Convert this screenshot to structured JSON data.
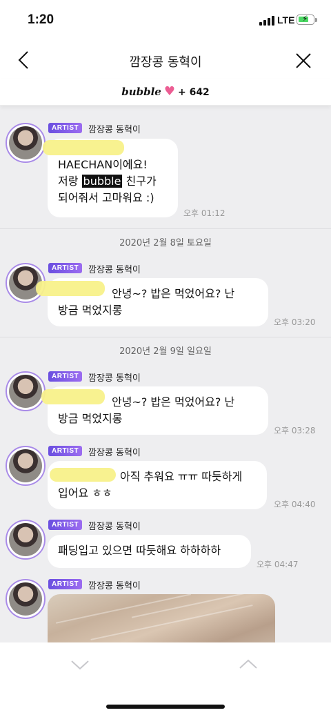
{
  "status_bar": {
    "time": "1:20",
    "network": "LTE"
  },
  "nav": {
    "title": "깜장콩 동혁이",
    "back_icon": "chevron-left-icon",
    "close_icon": "close-icon"
  },
  "banner": {
    "logo": "bubble",
    "count": "+ 642",
    "heart_color": "#ec5d93"
  },
  "colors": {
    "chat_bg": "#eeeef0",
    "badge": "#7c5ae8",
    "avatar_ring": "#a98be8"
  },
  "messages": [
    {
      "badge": "ARTIST",
      "sender": "깜장콩 동혁이",
      "lines": [
        "HAECHAN이에요!",
        "저랑",
        "bubble",
        "친구가",
        "되어줘서 고마워요 :)"
      ],
      "time": "오후 01:12"
    },
    {
      "badge": "ARTIST",
      "sender": "깜장콩 동혁이",
      "lines": [
        "안녕~? 밥은 먹었어요? 난",
        "방금 먹었지롱"
      ],
      "time": "오후 03:20"
    },
    {
      "badge": "ARTIST",
      "sender": "깜장콩 동혁이",
      "lines": [
        "안녕~? 밥은 먹었어요? 난",
        "방금 먹었지롱"
      ],
      "time": "오후 03:28"
    },
    {
      "badge": "ARTIST",
      "sender": "깜장콩 동혁이",
      "lines": [
        "아직 추워요 ㅠㅠ 따듯하게",
        "입어요 ㅎㅎ"
      ],
      "time": "오후 04:40"
    },
    {
      "badge": "ARTIST",
      "sender": "깜장콩 동혁이",
      "lines": [
        "패딩입고 있으면 따듯해요 하하하하"
      ],
      "time": "오후 04:47"
    },
    {
      "badge": "ARTIST",
      "sender": "깜장콩 동혁이"
    }
  ],
  "dates": [
    "2020년 2월 8일 토요일",
    "2020년 2월 9일 일요일"
  ],
  "bottom": {
    "down_icon": "chevron-down-icon",
    "up_icon": "chevron-up-icon"
  }
}
